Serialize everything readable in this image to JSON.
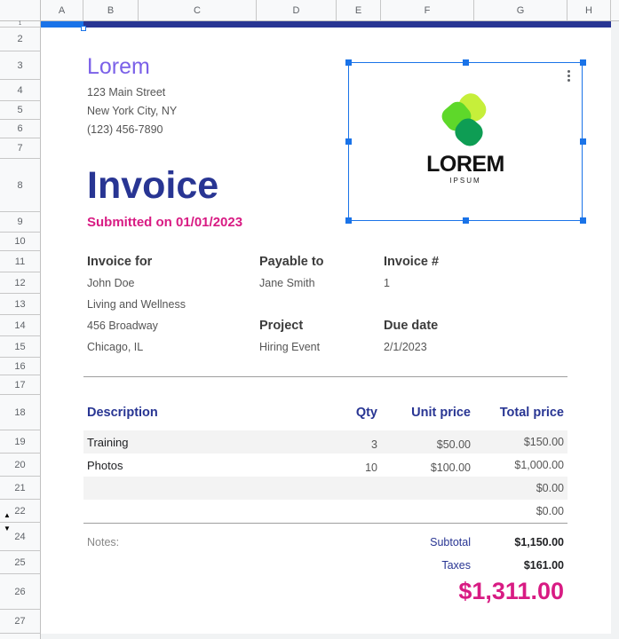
{
  "grid": {
    "columns": [
      "A",
      "B",
      "C",
      "D",
      "E",
      "F",
      "G",
      "H"
    ],
    "rows": [
      "1",
      "2",
      "3",
      "4",
      "5",
      "6",
      "7",
      "8",
      "9",
      "10",
      "11",
      "12",
      "13",
      "14",
      "15",
      "16",
      "17",
      "18",
      "19",
      "20",
      "21",
      "22",
      "24",
      "25",
      "26",
      "27"
    ]
  },
  "company": {
    "name": "Lorem",
    "street": "123 Main Street",
    "city": "New York City, NY",
    "phone": "(123) 456-7890"
  },
  "logo": {
    "word": "LOREM",
    "sub": "IPSUM",
    "icon": "leaf-logo-icon"
  },
  "invoice": {
    "title": "Invoice",
    "submitted": "Submitted on 01/01/2023"
  },
  "bill": {
    "invoice_for_label": "Invoice for",
    "client_name": "John Doe",
    "client_company": "Living and Wellness",
    "client_street": "456 Broadway",
    "client_city": "Chicago, IL",
    "payable_to_label": "Payable to",
    "payable_to": "Jane Smith",
    "project_label": "Project",
    "project": "Hiring Event",
    "invoice_no_label": "Invoice #",
    "invoice_no": "1",
    "due_date_label": "Due date",
    "due_date": "2/1/2023"
  },
  "table": {
    "headers": {
      "description": "Description",
      "qty": "Qty",
      "unit_price": "Unit price",
      "total_price": "Total price"
    },
    "rows": [
      {
        "description": "Training",
        "qty": "3",
        "unit_price": "$50.00",
        "total": "$150.00"
      },
      {
        "description": "Photos",
        "qty": "10",
        "unit_price": "$100.00",
        "total": "$1,000.00"
      },
      {
        "description": "",
        "qty": "",
        "unit_price": "",
        "total": "$0.00"
      },
      {
        "description": "",
        "qty": "",
        "unit_price": "",
        "total": "$0.00"
      }
    ]
  },
  "summary": {
    "notes_label": "Notes:",
    "subtotal_label": "Subtotal",
    "subtotal": "$1,150.00",
    "taxes_label": "Taxes",
    "taxes": "$161.00",
    "grand_total": "$1,311.00"
  },
  "colors": {
    "brand": "#283593",
    "accent": "#d81b83",
    "company": "#7b61e8",
    "selection": "#1a73e8"
  }
}
